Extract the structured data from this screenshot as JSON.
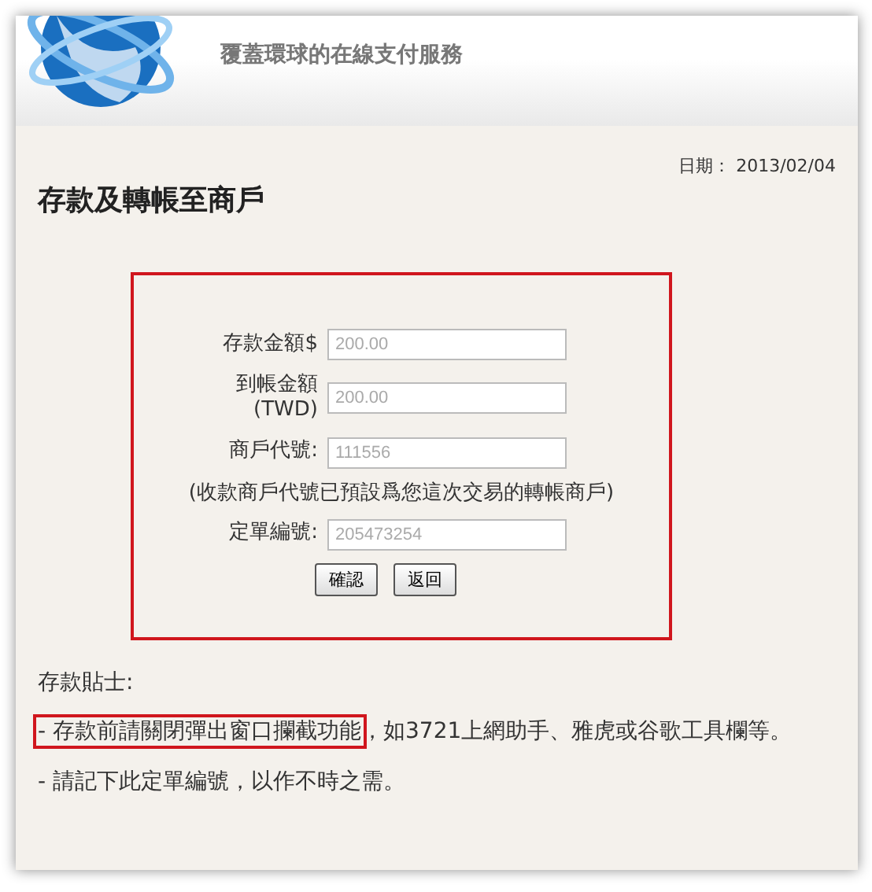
{
  "header": {
    "tagline": "覆蓋環球的在線支付服務"
  },
  "date": {
    "label": "日期：",
    "value": "2013/02/04"
  },
  "title": "存款及轉帳至商戶",
  "form": {
    "highlighted": true,
    "fields": [
      {
        "kind": "field",
        "label": "存款金額$",
        "value": "200.00",
        "disabled": true
      },
      {
        "kind": "field",
        "label": "到帳金額\n(TWD)",
        "value": "200.00",
        "disabled": true
      },
      {
        "kind": "field",
        "label": "商戶代號:",
        "value": "111556",
        "disabled": true
      },
      {
        "kind": "note",
        "label": "(收款商戶代號已預設爲您這次交易的轉帳商戶)"
      },
      {
        "kind": "field",
        "label": "定單編號:",
        "value": "205473254",
        "disabled": true
      }
    ],
    "buttons": [
      "確認",
      "返回"
    ]
  },
  "tips": {
    "heading": "存款貼士:",
    "items": [
      {
        "highlighted": true,
        "marked": "- 存款前請關閉彈出窗口攔截功能",
        "rest": "，如3721上網助手、雅虎或谷歌工具欄等。"
      },
      {
        "highlighted": false,
        "marked": "- 請記下此定單編號，以作不時之需。"
      }
    ]
  }
}
